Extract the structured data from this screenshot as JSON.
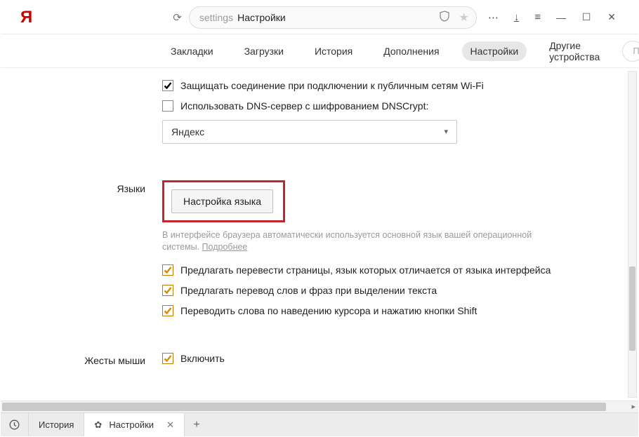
{
  "titlebar": {
    "logo": "Я",
    "url_dim": "settings",
    "url_title": "Настройки"
  },
  "nav": {
    "tabs": [
      "Закладки",
      "Загрузки",
      "История",
      "Дополнения",
      "Настройки",
      "Другие устройства"
    ],
    "active_index": 4,
    "search_placeholder": "Поиск н"
  },
  "security": {
    "wifi_protect": "Защищать соединение при подключении к публичным сетям Wi-Fi",
    "dnscrypt": "Использовать DNS-сервер с шифрованием DNSCrypt:",
    "dns_value": "Яндекс"
  },
  "languages": {
    "section_label": "Языки",
    "button": "Настройка языка",
    "hint": "В интерфейсе браузера автоматически используется основной язык вашей операционной системы. ",
    "hint_more": "Подробнее",
    "opt_translate_pages": "Предлагать перевести страницы, язык которых отличается от языка интерфейса",
    "opt_translate_selection": "Предлагать перевод слов и фраз при выделении текста",
    "opt_hover_shift": "Переводить слова по наведению курсора и нажатию кнопки Shift"
  },
  "gestures": {
    "section_label": "Жесты мыши",
    "enable": "Включить"
  },
  "tabstrip": {
    "history": "История",
    "settings": "Настройки"
  }
}
